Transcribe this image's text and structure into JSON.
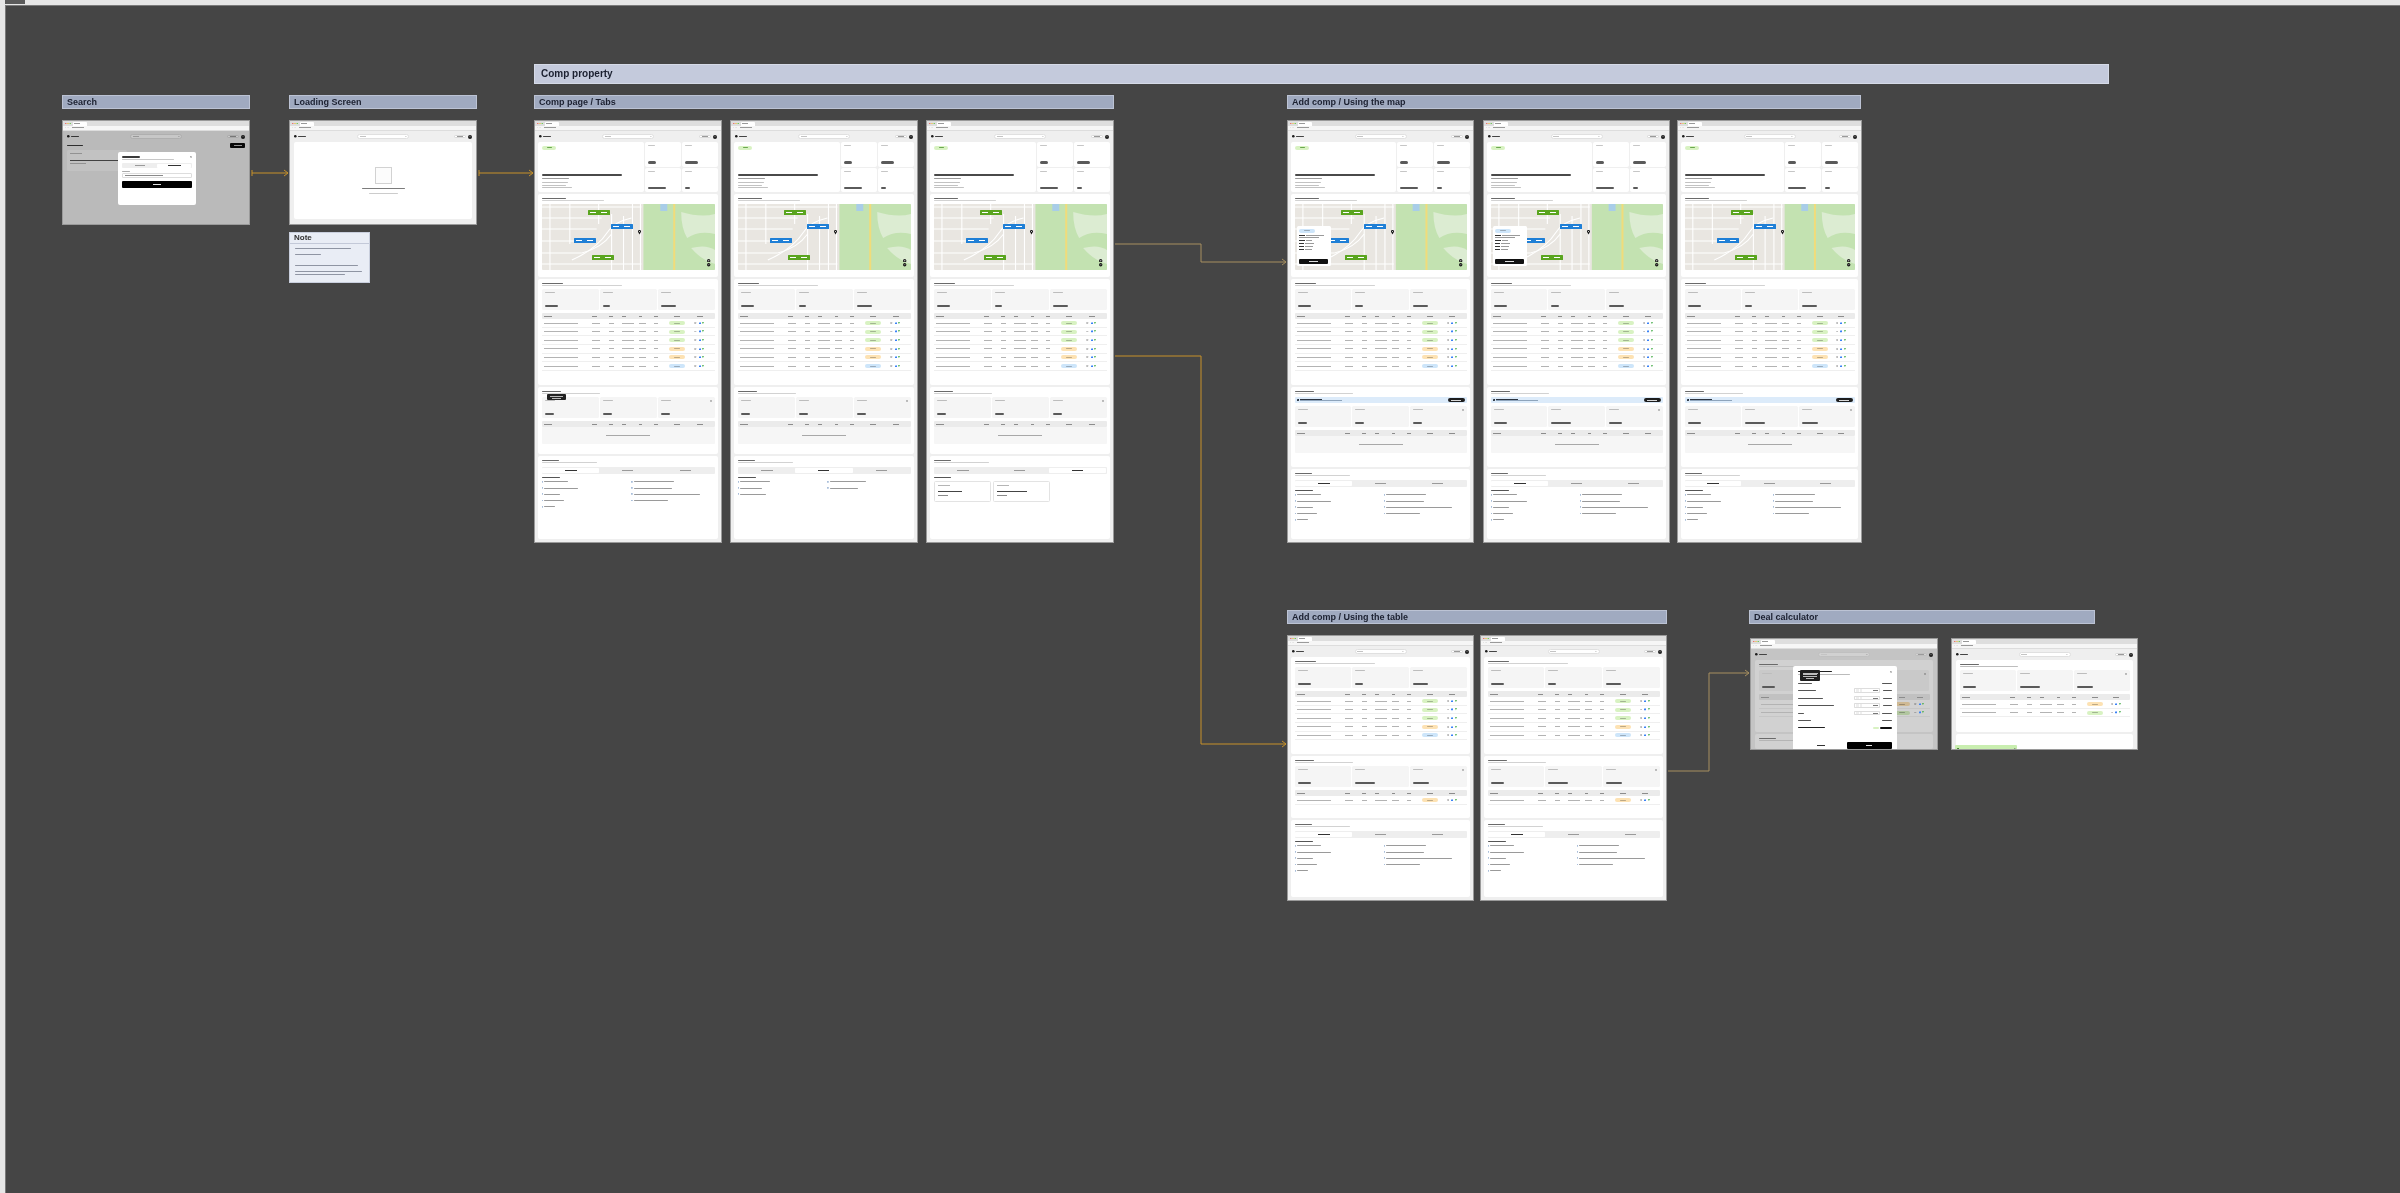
{
  "sections": [
    {
      "kind": "banner",
      "title": "Comp property"
    },
    {
      "kind": "group",
      "title": "Search"
    },
    {
      "kind": "group",
      "title": "Loading Screen"
    },
    {
      "kind": "group",
      "title": "Comp page / Tabs"
    },
    {
      "kind": "group",
      "title": "Add comp / Using the map"
    },
    {
      "kind": "group",
      "title": "Add comp / Using the table"
    },
    {
      "kind": "group",
      "title": "Deal calculator"
    }
  ],
  "note": {
    "title": "Note"
  },
  "frames": [
    {
      "kind": "search",
      "modal_tabs": [
        {
          "selected": false
        },
        {
          "selected": true
        }
      ]
    },
    {
      "kind": "loading"
    },
    {
      "kind": "comp_page",
      "suggested_rows": [
        {
          "color": "#d8f2c2"
        },
        {
          "color": "#d8f2c2"
        },
        {
          "color": "#d8f2c2"
        },
        {
          "color": "#fde2b3"
        },
        {
          "color": "#fde2b3"
        },
        {
          "color": "#cde5fa"
        }
      ],
      "tooltip_shown": true,
      "parcel_tabs": [
        {
          "selected": true
        },
        {
          "selected": false
        },
        {
          "selected": false
        }
      ]
    },
    {
      "kind": "comp_page",
      "suggested_rows": [
        {
          "color": "#d8f2c2"
        },
        {
          "color": "#d8f2c2"
        },
        {
          "color": "#d8f2c2"
        },
        {
          "color": "#fde2b3"
        },
        {
          "color": "#fde2b3"
        },
        {
          "color": "#cde5fa"
        }
      ],
      "parcel_tabs": [
        {
          "selected": false
        },
        {
          "selected": true
        },
        {
          "selected": false
        }
      ]
    },
    {
      "kind": "comp_page",
      "suggested_rows": [
        {
          "color": "#d8f2c2"
        },
        {
          "color": "#d8f2c2"
        },
        {
          "color": "#d8f2c2"
        },
        {
          "color": "#fde2b3"
        },
        {
          "color": "#fde2b3"
        },
        {
          "color": "#cde5fa"
        }
      ],
      "parcel_tabs": [
        {
          "selected": false
        },
        {
          "selected": false
        },
        {
          "selected": true
        }
      ]
    },
    {
      "kind": "comp_page",
      "map_popup": {
        "color": "#cde5fa"
      },
      "suggested_rows": [
        {
          "color": "#d8f2c2"
        },
        {
          "color": "#d8f2c2"
        },
        {
          "color": "#d8f2c2"
        },
        {
          "color": "#fde2b3"
        },
        {
          "color": "#fde2b3"
        },
        {
          "color": "#cde5fa"
        }
      ],
      "banner_shown": true,
      "parcel_tabs": [
        {
          "selected": true
        },
        {
          "selected": false
        },
        {
          "selected": false
        }
      ]
    },
    {
      "kind": "comp_page",
      "map_popup": {
        "color": "#cde5fa"
      },
      "suggested_rows": [
        {
          "color": "#d8f2c2"
        },
        {
          "color": "#d8f2c2"
        },
        {
          "color": "#d8f2c2"
        },
        {
          "color": "#fde2b3"
        },
        {
          "color": "#fde2b3"
        },
        {
          "color": "#cde5fa"
        }
      ],
      "banner_shown": true,
      "parcel_tabs": [
        {
          "selected": true
        },
        {
          "selected": false
        },
        {
          "selected": false
        }
      ]
    },
    {
      "kind": "comp_page",
      "suggested_rows": [
        {
          "color": "#d8f2c2"
        },
        {
          "color": "#d8f2c2"
        },
        {
          "color": "#d8f2c2"
        },
        {
          "color": "#fde2b3"
        },
        {
          "color": "#fde2b3"
        },
        {
          "color": "#cde5fa"
        }
      ],
      "banner_shown": true,
      "parcel_tabs": [
        {
          "selected": true
        },
        {
          "selected": false
        },
        {
          "selected": false
        }
      ]
    },
    {
      "kind": "table_page",
      "suggested_rows": [
        {
          "color": "#d8f2c2"
        },
        {
          "color": "#d8f2c2"
        },
        {
          "color": "#d8f2c2"
        },
        {
          "color": "#fde2b3"
        },
        {
          "color": "#cde5fa"
        }
      ],
      "selected_rows": [
        {
          "color": "#fde2b3"
        }
      ],
      "parcel_tabs": [
        {
          "selected": true
        },
        {
          "selected": false
        },
        {
          "selected": false
        }
      ]
    },
    {
      "kind": "table_page",
      "suggested_rows": [
        {
          "color": "#d8f2c2"
        },
        {
          "color": "#d8f2c2"
        },
        {
          "color": "#d8f2c2"
        },
        {
          "color": "#fde2b3"
        },
        {
          "color": "#cde5fa"
        }
      ],
      "selected_rows": [
        {
          "color": "#fde2b3"
        }
      ],
      "parcel_tabs": [
        {
          "selected": true
        },
        {
          "selected": false
        },
        {
          "selected": false
        }
      ]
    },
    {
      "kind": "deal_modal",
      "selected_rows": [
        {
          "color": "#cfb993"
        },
        {
          "color": "#b1c69f"
        }
      ]
    },
    {
      "kind": "deal_result",
      "selected_rows": [
        {
          "color": "#fde2b3"
        },
        {
          "color": "#d8f2c2"
        }
      ]
    }
  ]
}
